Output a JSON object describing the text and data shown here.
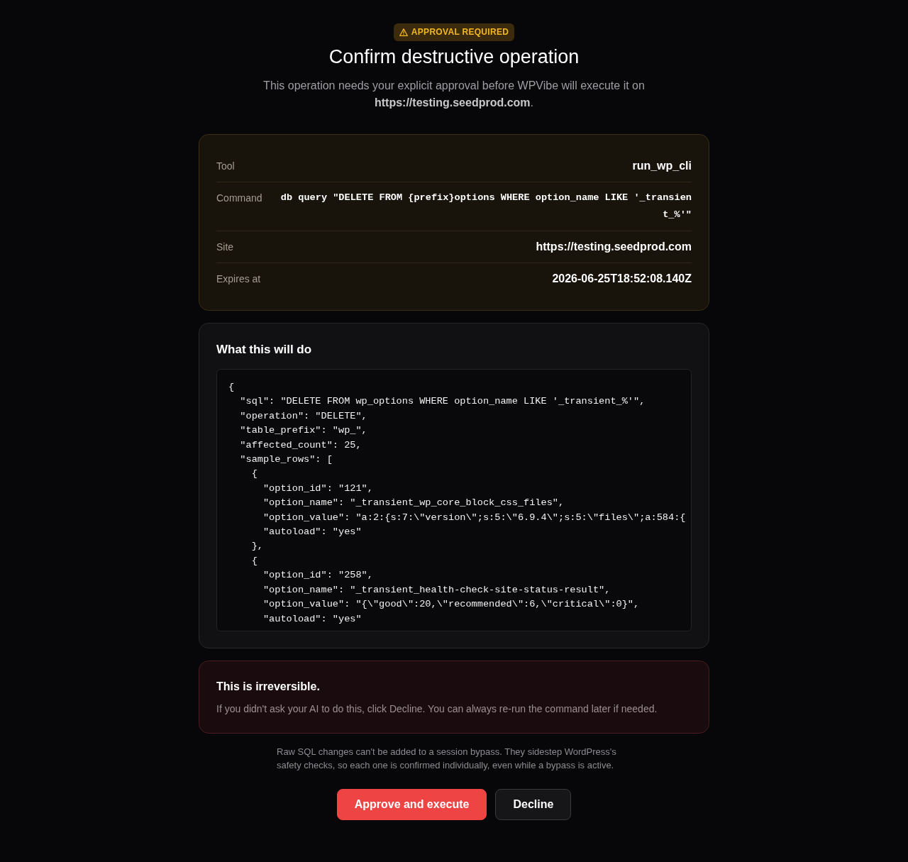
{
  "badge": {
    "label": "APPROVAL REQUIRED"
  },
  "title": "Confirm destructive operation",
  "subtitle": "This operation needs your explicit approval before WPVibe will execute it on **https://testing.seedprod.com**.",
  "details": [
    {
      "label": "Tool",
      "value": "run_wp_cli",
      "kind": "text"
    },
    {
      "label": "Command",
      "value": "db query \"DELETE FROM {prefix}options WHERE option_name LIKE '_transient_%'\"",
      "kind": "code"
    },
    {
      "label": "Site",
      "value": "https://testing.seedprod.com",
      "kind": "text"
    },
    {
      "label": "Expires at",
      "value": "2026-06-25T18:52:08.140Z",
      "kind": "text"
    }
  ],
  "preview": {
    "heading": "What this will do",
    "code_lines": [
      "{",
      "  \"sql\": \"DELETE FROM wp_options WHERE option_name LIKE '_transient_%'\",",
      "  \"operation\": \"DELETE\",",
      "  \"table_prefix\": \"wp_\",",
      "  \"affected_count\": 25,",
      "  \"sample_rows\": [",
      "    {",
      "      \"option_id\": \"121\",",
      "      \"option_name\": \"_transient_wp_core_block_css_files\",",
      "      \"option_value\": \"a:2:{s:7:\\\"version\\\";s:5:\\\"6.9.4\\\";s:5:\\\"files\\\";a:584:{",
      "      \"autoload\": \"yes\"",
      "    },",
      "    {",
      "      \"option_id\": \"258\",",
      "      \"option_name\": \"_transient_health-check-site-status-result\",",
      "      \"option_value\": \"{\\\"good\\\":20,\\\"recommended\\\":6,\\\"critical\\\":0}\",",
      "      \"autoload\": \"yes\""
    ]
  },
  "warning": {
    "heading": "This is irreversible.",
    "text": "If you didn't ask your AI to do this, click Decline. You can always re-run the command later if needed."
  },
  "note": "Raw SQL changes can't be added to a session bypass. They sidestep WordPress's safety checks, so each one is confirmed individually, even while a bypass is active.",
  "buttons": [
    {
      "label": "Approve and execute",
      "kind": "primary"
    },
    {
      "label": "Decline",
      "kind": "secondary"
    }
  ]
}
